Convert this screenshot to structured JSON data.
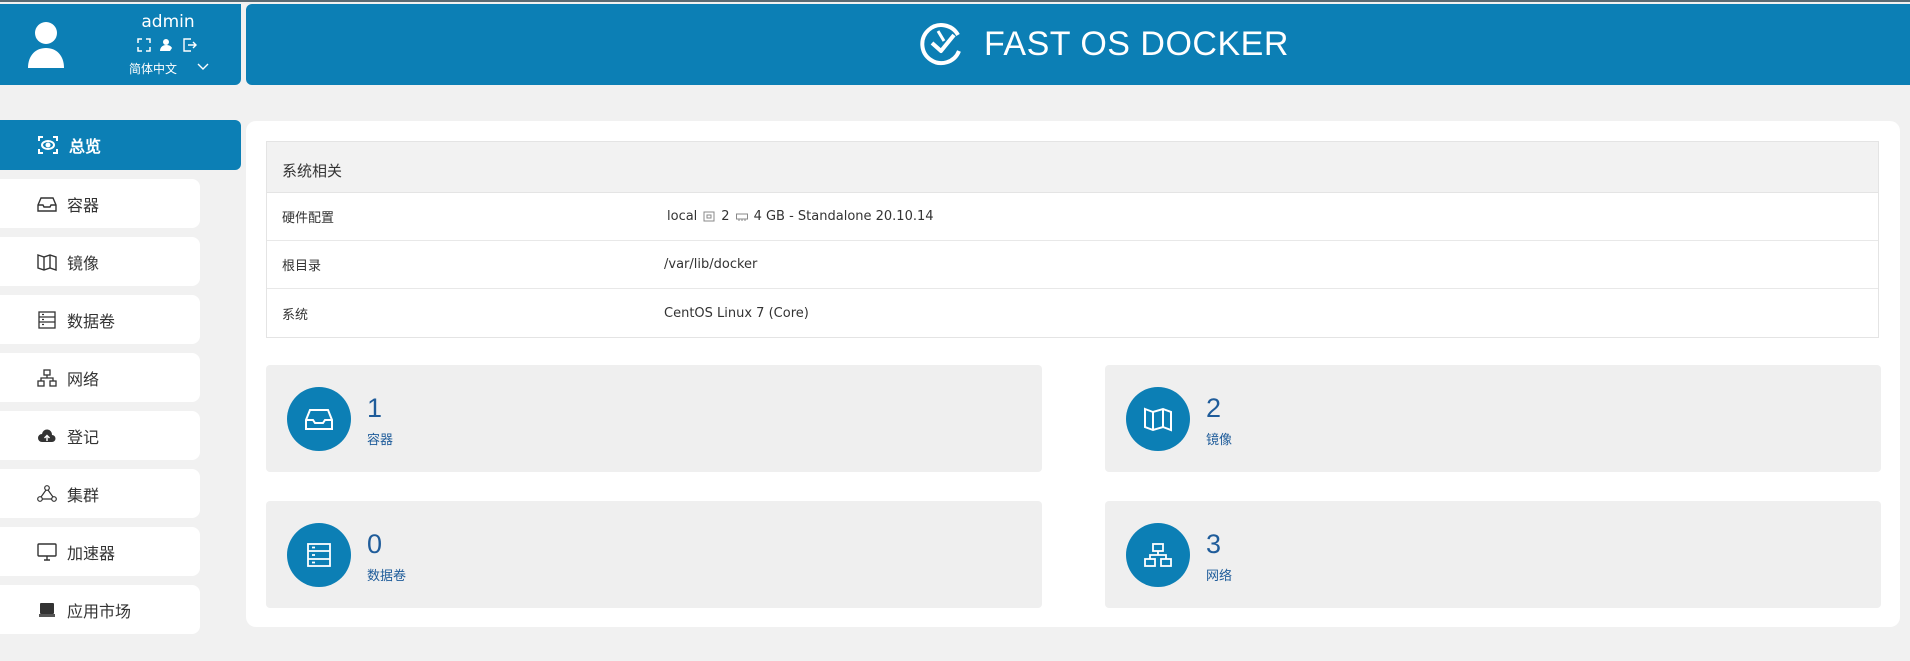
{
  "user": {
    "name": "admin",
    "language": "简体中文"
  },
  "brand": {
    "title": "FAST OS DOCKER"
  },
  "nav": {
    "items": [
      {
        "label": "总览",
        "icon": "eye-scan-icon",
        "active": true
      },
      {
        "label": "容器",
        "icon": "inbox-icon"
      },
      {
        "label": "镜像",
        "icon": "map-icon"
      },
      {
        "label": "数据卷",
        "icon": "database-icon"
      },
      {
        "label": "网络",
        "icon": "network-icon"
      },
      {
        "label": "登记",
        "icon": "cloud-upload-icon"
      },
      {
        "label": "集群",
        "icon": "cluster-icon"
      },
      {
        "label": "加速器",
        "icon": "monitor-icon"
      },
      {
        "label": "应用市场",
        "icon": "store-icon"
      }
    ]
  },
  "system": {
    "title": "系统相关",
    "rows": [
      {
        "key": "硬件配置",
        "host": "local",
        "cpu": "2",
        "memory": "4 GB - Standalone 20.10.14"
      },
      {
        "key": "根目录",
        "value": "/var/lib/docker"
      },
      {
        "key": "系统",
        "value": "CentOS Linux 7 (Core)"
      }
    ]
  },
  "stats": [
    {
      "value": "1",
      "label": "容器",
      "icon": "inbox-icon"
    },
    {
      "value": "2",
      "label": "镜像",
      "icon": "map-icon"
    },
    {
      "value": "0",
      "label": "数据卷",
      "icon": "database-icon"
    },
    {
      "value": "3",
      "label": "网络",
      "icon": "network-icon"
    }
  ],
  "colors": {
    "primary": "#0c7fb5",
    "stat_text": "#1f5c9a",
    "background": "#f1f1f1"
  }
}
